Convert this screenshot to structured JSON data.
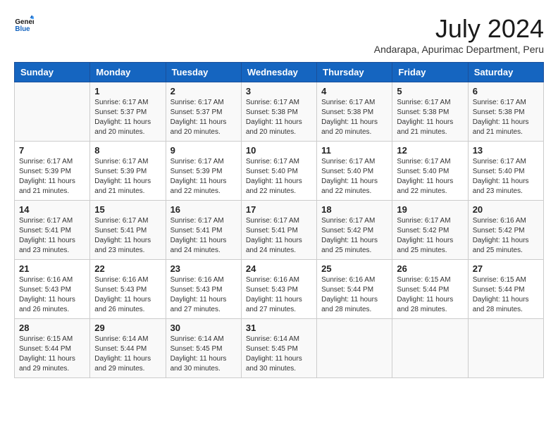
{
  "header": {
    "logo_general": "General",
    "logo_blue": "Blue",
    "month_year": "July 2024",
    "location": "Andarapa, Apurimac Department, Peru"
  },
  "weekdays": [
    "Sunday",
    "Monday",
    "Tuesday",
    "Wednesday",
    "Thursday",
    "Friday",
    "Saturday"
  ],
  "weeks": [
    [
      {
        "day": "",
        "sunrise": "",
        "sunset": "",
        "daylight": ""
      },
      {
        "day": "1",
        "sunrise": "Sunrise: 6:17 AM",
        "sunset": "Sunset: 5:37 PM",
        "daylight": "Daylight: 11 hours and 20 minutes."
      },
      {
        "day": "2",
        "sunrise": "Sunrise: 6:17 AM",
        "sunset": "Sunset: 5:37 PM",
        "daylight": "Daylight: 11 hours and 20 minutes."
      },
      {
        "day": "3",
        "sunrise": "Sunrise: 6:17 AM",
        "sunset": "Sunset: 5:38 PM",
        "daylight": "Daylight: 11 hours and 20 minutes."
      },
      {
        "day": "4",
        "sunrise": "Sunrise: 6:17 AM",
        "sunset": "Sunset: 5:38 PM",
        "daylight": "Daylight: 11 hours and 20 minutes."
      },
      {
        "day": "5",
        "sunrise": "Sunrise: 6:17 AM",
        "sunset": "Sunset: 5:38 PM",
        "daylight": "Daylight: 11 hours and 21 minutes."
      },
      {
        "day": "6",
        "sunrise": "Sunrise: 6:17 AM",
        "sunset": "Sunset: 5:38 PM",
        "daylight": "Daylight: 11 hours and 21 minutes."
      }
    ],
    [
      {
        "day": "7",
        "sunrise": "Sunrise: 6:17 AM",
        "sunset": "Sunset: 5:39 PM",
        "daylight": "Daylight: 11 hours and 21 minutes."
      },
      {
        "day": "8",
        "sunrise": "Sunrise: 6:17 AM",
        "sunset": "Sunset: 5:39 PM",
        "daylight": "Daylight: 11 hours and 21 minutes."
      },
      {
        "day": "9",
        "sunrise": "Sunrise: 6:17 AM",
        "sunset": "Sunset: 5:39 PM",
        "daylight": "Daylight: 11 hours and 22 minutes."
      },
      {
        "day": "10",
        "sunrise": "Sunrise: 6:17 AM",
        "sunset": "Sunset: 5:40 PM",
        "daylight": "Daylight: 11 hours and 22 minutes."
      },
      {
        "day": "11",
        "sunrise": "Sunrise: 6:17 AM",
        "sunset": "Sunset: 5:40 PM",
        "daylight": "Daylight: 11 hours and 22 minutes."
      },
      {
        "day": "12",
        "sunrise": "Sunrise: 6:17 AM",
        "sunset": "Sunset: 5:40 PM",
        "daylight": "Daylight: 11 hours and 22 minutes."
      },
      {
        "day": "13",
        "sunrise": "Sunrise: 6:17 AM",
        "sunset": "Sunset: 5:40 PM",
        "daylight": "Daylight: 11 hours and 23 minutes."
      }
    ],
    [
      {
        "day": "14",
        "sunrise": "Sunrise: 6:17 AM",
        "sunset": "Sunset: 5:41 PM",
        "daylight": "Daylight: 11 hours and 23 minutes."
      },
      {
        "day": "15",
        "sunrise": "Sunrise: 6:17 AM",
        "sunset": "Sunset: 5:41 PM",
        "daylight": "Daylight: 11 hours and 23 minutes."
      },
      {
        "day": "16",
        "sunrise": "Sunrise: 6:17 AM",
        "sunset": "Sunset: 5:41 PM",
        "daylight": "Daylight: 11 hours and 24 minutes."
      },
      {
        "day": "17",
        "sunrise": "Sunrise: 6:17 AM",
        "sunset": "Sunset: 5:41 PM",
        "daylight": "Daylight: 11 hours and 24 minutes."
      },
      {
        "day": "18",
        "sunrise": "Sunrise: 6:17 AM",
        "sunset": "Sunset: 5:42 PM",
        "daylight": "Daylight: 11 hours and 25 minutes."
      },
      {
        "day": "19",
        "sunrise": "Sunrise: 6:17 AM",
        "sunset": "Sunset: 5:42 PM",
        "daylight": "Daylight: 11 hours and 25 minutes."
      },
      {
        "day": "20",
        "sunrise": "Sunrise: 6:16 AM",
        "sunset": "Sunset: 5:42 PM",
        "daylight": "Daylight: 11 hours and 25 minutes."
      }
    ],
    [
      {
        "day": "21",
        "sunrise": "Sunrise: 6:16 AM",
        "sunset": "Sunset: 5:43 PM",
        "daylight": "Daylight: 11 hours and 26 minutes."
      },
      {
        "day": "22",
        "sunrise": "Sunrise: 6:16 AM",
        "sunset": "Sunset: 5:43 PM",
        "daylight": "Daylight: 11 hours and 26 minutes."
      },
      {
        "day": "23",
        "sunrise": "Sunrise: 6:16 AM",
        "sunset": "Sunset: 5:43 PM",
        "daylight": "Daylight: 11 hours and 27 minutes."
      },
      {
        "day": "24",
        "sunrise": "Sunrise: 6:16 AM",
        "sunset": "Sunset: 5:43 PM",
        "daylight": "Daylight: 11 hours and 27 minutes."
      },
      {
        "day": "25",
        "sunrise": "Sunrise: 6:16 AM",
        "sunset": "Sunset: 5:44 PM",
        "daylight": "Daylight: 11 hours and 28 minutes."
      },
      {
        "day": "26",
        "sunrise": "Sunrise: 6:15 AM",
        "sunset": "Sunset: 5:44 PM",
        "daylight": "Daylight: 11 hours and 28 minutes."
      },
      {
        "day": "27",
        "sunrise": "Sunrise: 6:15 AM",
        "sunset": "Sunset: 5:44 PM",
        "daylight": "Daylight: 11 hours and 28 minutes."
      }
    ],
    [
      {
        "day": "28",
        "sunrise": "Sunrise: 6:15 AM",
        "sunset": "Sunset: 5:44 PM",
        "daylight": "Daylight: 11 hours and 29 minutes."
      },
      {
        "day": "29",
        "sunrise": "Sunrise: 6:14 AM",
        "sunset": "Sunset: 5:44 PM",
        "daylight": "Daylight: 11 hours and 29 minutes."
      },
      {
        "day": "30",
        "sunrise": "Sunrise: 6:14 AM",
        "sunset": "Sunset: 5:45 PM",
        "daylight": "Daylight: 11 hours and 30 minutes."
      },
      {
        "day": "31",
        "sunrise": "Sunrise: 6:14 AM",
        "sunset": "Sunset: 5:45 PM",
        "daylight": "Daylight: 11 hours and 30 minutes."
      },
      {
        "day": "",
        "sunrise": "",
        "sunset": "",
        "daylight": ""
      },
      {
        "day": "",
        "sunrise": "",
        "sunset": "",
        "daylight": ""
      },
      {
        "day": "",
        "sunrise": "",
        "sunset": "",
        "daylight": ""
      }
    ]
  ]
}
